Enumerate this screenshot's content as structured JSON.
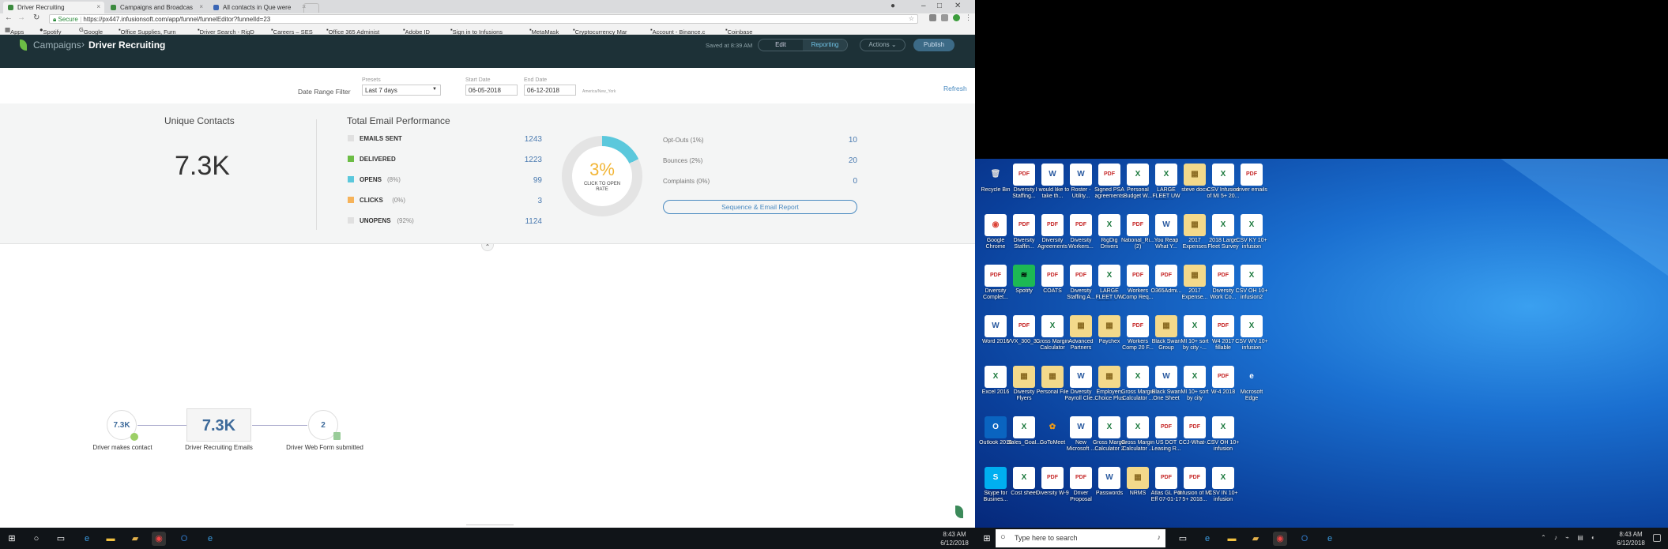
{
  "browser": {
    "tabs": [
      {
        "label": "Driver Recruiting",
        "color": "#3b8a3e"
      },
      {
        "label": "Campaigns and Broadcas",
        "color": "#3b8a3e"
      },
      {
        "label": "All contacts in Que were",
        "color": "#3a66b5"
      }
    ],
    "secure_label": "Secure",
    "url": "https://px447.infusionsoft.com/app/funnel/funnelEditor?funnelId=23",
    "bookmarks": [
      "Apps",
      "Spotify",
      "Google",
      "Office Supplies, Furn",
      "Driver Search - RigD",
      "Careers – SES",
      "Office 365 Administ",
      "Adobe ID",
      "Sign in to Infusions",
      "MetaMask",
      "Cryptocurrency Mar",
      "Account - Binance.c",
      "Coinbase"
    ]
  },
  "app": {
    "breadcrumb_parent": "Campaigns",
    "breadcrumb_sep": "›",
    "title": "Driver Recruiting",
    "saved_text": "Saved at 8:39 AM",
    "edit_label": "Edit",
    "reporting_label": "Reporting",
    "actions_label": "Actions ⌄",
    "publish_label": "Publish"
  },
  "filter": {
    "label": "Date Range Filter",
    "presets_label": "Presets",
    "presets_value": "Last 7 days",
    "start_label": "Start Date",
    "start_value": "06-05-2018",
    "end_label": "End Date",
    "end_value": "06-12-2018",
    "tz": "America/New_York",
    "refresh": "Refresh"
  },
  "stats": {
    "unique_title": "Unique Contacts",
    "unique_value": "7.3K",
    "email_title": "Total Email Performance",
    "rows": [
      {
        "label": "EMAILS SENT",
        "pct": "",
        "value": "1243",
        "color": "#e0e0e0"
      },
      {
        "label": "DELIVERED",
        "pct": "",
        "value": "1223",
        "color": "#6cbd45"
      },
      {
        "label": "OPENS",
        "pct": "(8%)",
        "value": "99",
        "color": "#5bc8dc"
      },
      {
        "label": "CLICKS",
        "pct": "(0%)",
        "value": "3",
        "color": "#f6b35a"
      },
      {
        "label": "UNOPENS",
        "pct": "(92%)",
        "value": "1124",
        "color": "#e0e0e0"
      }
    ],
    "open_rate": "3%",
    "open_rate_fraction": 0.03,
    "open_caption": "CLICK TO OPEN RATE",
    "right_rows": [
      {
        "label": "Opt-Outs (1%)",
        "value": "10"
      },
      {
        "label": "Bounces (2%)",
        "value": "20"
      },
      {
        "label": "Complaints (0%)",
        "value": "0"
      }
    ],
    "report_button": "Sequence & Email Report"
  },
  "funnel": {
    "node1_value": "7.3K",
    "node1_label": "Driver makes contact",
    "node2_value": "7.3K",
    "node2_label": "Driver Recruiting Emails",
    "node3_value": "2",
    "node3_label": "Driver Web Form submitted"
  },
  "desktop": {
    "icons": [
      [
        "Recycle Bin",
        "Diversity Staffing...",
        "I would like to take th...",
        "Roster - Utility...",
        "Signed PSA agreements",
        "Personal Budget W...",
        "LARGE FLEET UW PACK 1...",
        "steve docx",
        "CSV Infusion of MI 5+ 20...",
        "driver emails"
      ],
      [
        "Google Chrome",
        "Diversity Staffin...",
        "Diversity Agreements",
        "Diversity Workers...",
        "RigDig Drivers",
        "National_Ri... (2)",
        "You Reap What Y...",
        "2017 Expenses",
        "2018 Large Fleet Survey",
        "CSV KY 10+ infusion"
      ],
      [
        "Diversity Complet...",
        "Spotify",
        "COATS",
        "Diversity Staffing A...",
        "LARGE FLEET UW PACK 1...",
        "Workers Comp Req...",
        "O365Admi...",
        "2017 Expense...",
        "Diversity Work Co...",
        "CSV OH 10+ infusion2"
      ],
      [
        "Word 2016",
        "VVX_300_3...",
        "Gross Margin Calculator",
        "Advanced Partners",
        "Paychex",
        "Workers Comp 20 F...",
        "Black Swan Group",
        "MI 10+ sort by city -...",
        "W4 2017 fillable",
        "CSV WV 10+ infusion"
      ],
      [
        "Excel 2016",
        "Diversity Flyers",
        "Personal File",
        "Diversity Payroll Clie...",
        "Employers Choice Plus",
        "Gross Margin Calculator ...",
        "Black Swan One Sheet",
        "MI 10+ sort by city",
        "W-4 2018",
        "Microsoft Edge"
      ],
      [
        "Outlook 2016",
        "Sales_Goal...",
        "GoToMeet",
        "New Microsoft ...",
        "Gross Margin Calculator 2",
        "Gross Margin Calculator ...",
        "US DOT Leasing R...",
        "CCJ-What-...",
        "CSV OH 10+ infusion",
        ""
      ],
      [
        "Skype for Busines...",
        "Cost sheet",
        "Diversity W-9",
        "Driver Proposal",
        "Passwords",
        "NRMS",
        "Atlas GL Pol Eff 07-01-17",
        "Infusion of MI 5+ 2018...",
        "CSV IN 10+ infusion",
        ""
      ]
    ]
  },
  "taskbar": {
    "search_placeholder": "Type here to search",
    "time": "8:43 AM",
    "date": "6/12/2018"
  }
}
